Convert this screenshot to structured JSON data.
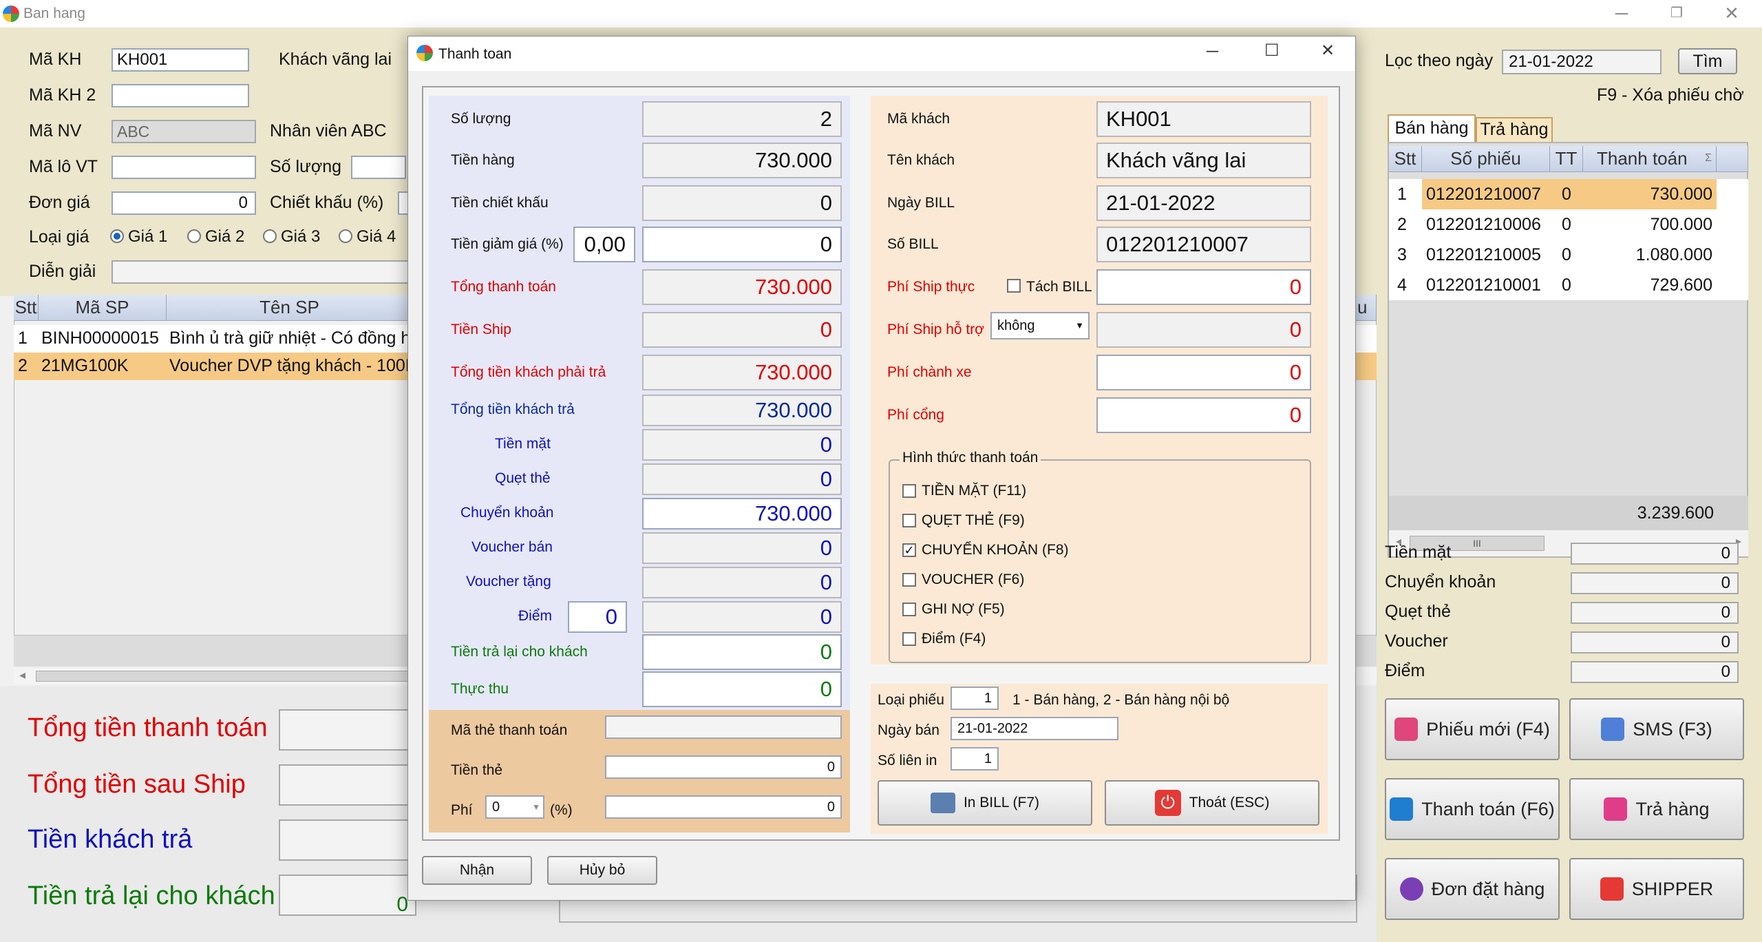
{
  "app": {
    "title": "Ban hang"
  },
  "left": {
    "ma_kh_label": "Mã KH",
    "ma_kh": "KH001",
    "khach_name": "Khách vãng lai",
    "ma_kh2_label": "Mã KH 2",
    "ma_nv_label": "Mã NV",
    "ma_nv": "ABC",
    "nhan_vien": "Nhân viên ABC",
    "ma_lo_label": "Mã lô VT",
    "so_luong_label": "Số lượng",
    "don_gia_label": "Đơn giá",
    "don_gia": "0",
    "chiet_khau_label": "Chiết khấu (%)",
    "loai_gia_label": "Loại giá",
    "gia_options": [
      "Giá 1",
      "Giá 2",
      "Giá 3",
      "Giá 4"
    ],
    "dien_giai_label": "Diễn giải",
    "table": {
      "headers": [
        "Stt",
        "Mã SP",
        "Tên SP"
      ],
      "rows": [
        {
          "stt": "1",
          "ma": "BINH00000015",
          "ten": "Bình ủ trà giữ nhiệt - Có đồng h"
        },
        {
          "stt": "2",
          "ma": "21MG100K",
          "ten": "Voucher DVP tặng khách - 100K"
        }
      ],
      "partial_header": "u"
    },
    "totals": {
      "tong_tt": "Tổng tiền thanh toán",
      "tong_sau_ship": "Tổng tiền sau Ship",
      "tien_khach_tra": "Tiền khách trả",
      "tien_tra_lai": "Tiền trả lại cho khách",
      "tien_tra_lai_value": "0"
    }
  },
  "right": {
    "loc_label": "Lọc theo ngày",
    "loc_date": "21-01-2022",
    "tim": "Tìm",
    "f9_hint": "F9 - Xóa phiếu chờ",
    "tabs": [
      "Bán hàng",
      "Trả hàng"
    ],
    "table": {
      "headers": [
        "Stt",
        "Số phiếu",
        "TT",
        "Thanh toán"
      ],
      "sigma": "Σ",
      "rows": [
        {
          "stt": "1",
          "so": "012201210007",
          "tt": "0",
          "tien": "730.000"
        },
        {
          "stt": "2",
          "so": "012201210006",
          "tt": "0",
          "tien": "700.000"
        },
        {
          "stt": "3",
          "so": "012201210005",
          "tt": "0",
          "tien": "1.080.000"
        },
        {
          "stt": "4",
          "so": "012201210001",
          "tt": "0",
          "tien": "729.600"
        }
      ],
      "total": "3.239.600",
      "scroll_grip": "III"
    },
    "summary": [
      {
        "label": "Tiền mặt",
        "value": "0"
      },
      {
        "label": "Chuyển khoản",
        "value": "0"
      },
      {
        "label": "Quẹt thẻ",
        "value": "0"
      },
      {
        "label": "Voucher",
        "value": "0"
      },
      {
        "label": "Điểm",
        "value": "0"
      }
    ],
    "buttons": {
      "phieu_moi": "Phiếu mới (F4)",
      "sms": "SMS (F3)",
      "thanh_toan": "Thanh toán (F6)",
      "tra_hang": "Trả hàng",
      "don_dat_hang": "Đơn đặt hàng",
      "shipper": "SHIPPER"
    }
  },
  "dialog": {
    "title": "Thanh toan",
    "so_luong_label": "Số lượng",
    "so_luong": "2",
    "tien_hang_label": "Tiền hàng",
    "tien_hang": "730.000",
    "tien_ck_label": "Tiền chiết khấu",
    "tien_ck": "0",
    "giam_gia_label": "Tiền giảm giá (%)",
    "giam_gia_pct": "0,00",
    "giam_gia": "0",
    "tong_tt_label": "Tổng thanh toán",
    "tong_tt": "730.000",
    "tien_ship_label": "Tiền Ship",
    "tien_ship": "0",
    "tong_phai_tra_label": "Tổng tiền khách phải trả",
    "tong_phai_tra": "730.000",
    "tong_khach_tra_label": "Tổng tiền khách trả",
    "tong_khach_tra": "730.000",
    "tien_mat_label": "Tiền mặt",
    "tien_mat": "0",
    "quet_the_label": "Quẹt thẻ",
    "quet_the": "0",
    "chuyen_khoan_label": "Chuyển khoản",
    "chuyen_khoan": "730.000",
    "voucher_ban_label": "Voucher bán",
    "voucher_ban": "0",
    "voucher_tang_label": "Voucher tặng",
    "voucher_tang": "0",
    "diem_label": "Điểm",
    "diem_input": "0",
    "diem": "0",
    "tien_tra_lai_label": "Tiền trả lại cho khách",
    "tien_tra_lai": "0",
    "thuc_thu_label": "Thực thu",
    "thuc_thu": "0",
    "ma_the_label": "Mã thẻ thanh toán",
    "tien_the_label": "Tiền thẻ",
    "tien_the": "0",
    "phi_label": "Phí",
    "phi_select": "0",
    "phi_pct": "(%)",
    "phi": "0",
    "ma_khach_label": "Mã khách",
    "ma_khach": "KH001",
    "ten_khach_label": "Tên khách",
    "ten_khach": "Khách vãng lai",
    "ngay_bill_label": "Ngày BILL",
    "ngay_bill": "21-01-2022",
    "so_bill_label": "Số BILL",
    "so_bill": "012201210007",
    "phi_ship_thuc_label": "Phí Ship thực",
    "tach_bill": "Tách BILL",
    "phi_ship_thuc": "0",
    "phi_ship_ho_tro_label": "Phí Ship hỗ trợ",
    "ho_tro_select": "không",
    "phi_ship_ho_tro": "0",
    "phi_chanh_xe_label": "Phí chành xe",
    "phi_chanh_xe": "0",
    "phi_cong_label": "Phí cổng",
    "phi_cong": "0",
    "hinh_thuc_label": "Hình thức thanh toán",
    "methods": [
      {
        "label": "TIỀN MẶT (F11)",
        "checked": false
      },
      {
        "label": "QUẸT THẺ (F9)",
        "checked": false
      },
      {
        "label": "CHUYỂN KHOẢN (F8)",
        "checked": true
      },
      {
        "label": "VOUCHER (F6)",
        "checked": false
      },
      {
        "label": "GHI NỢ (F5)",
        "checked": false
      },
      {
        "label": "Điểm (F4)",
        "checked": false
      }
    ],
    "loai_phieu_label": "Loại phiếu",
    "loai_phieu": "1",
    "loai_phieu_hint": "1 - Bán hàng, 2 - Bán hàng nội bộ",
    "ngay_ban_label": "Ngày bán",
    "ngay_ban": "21-01-2022",
    "so_lien_label": "Số liên in",
    "so_lien": "1",
    "in_bill": "In BILL (F7)",
    "thoat": "Thoát (ESC)",
    "nhan": "Nhận",
    "huy_bo": "Hủy bỏ"
  }
}
